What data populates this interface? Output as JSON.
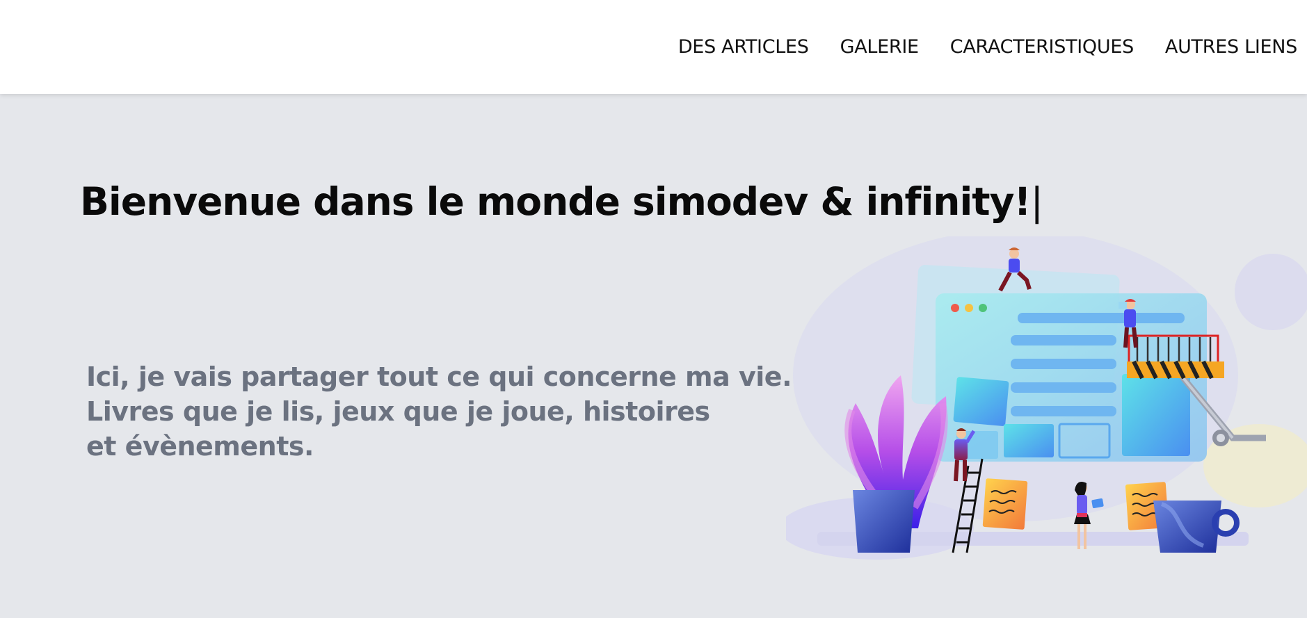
{
  "nav": {
    "items": [
      {
        "label": "DES ARTICLES"
      },
      {
        "label": "GALERIE"
      },
      {
        "label": "CARACTERISTIQUES"
      },
      {
        "label": "AUTRES LIENS"
      }
    ]
  },
  "hero": {
    "title": "Bienvenue dans le monde simodev & infinity!",
    "cursor": "|",
    "description_lines": [
      "Ici, je vais partager tout ce qui concerne ma vie.",
      "Livres que je lis, jeux que je joue, histoires",
      "et évènements."
    ]
  },
  "colors": {
    "nav_background": "#ffffff",
    "page_background": "#e5e7eb",
    "title": "#0a0a0a",
    "description": "#6b7280"
  },
  "illustration": {
    "icon": "website-construction-illustration"
  }
}
